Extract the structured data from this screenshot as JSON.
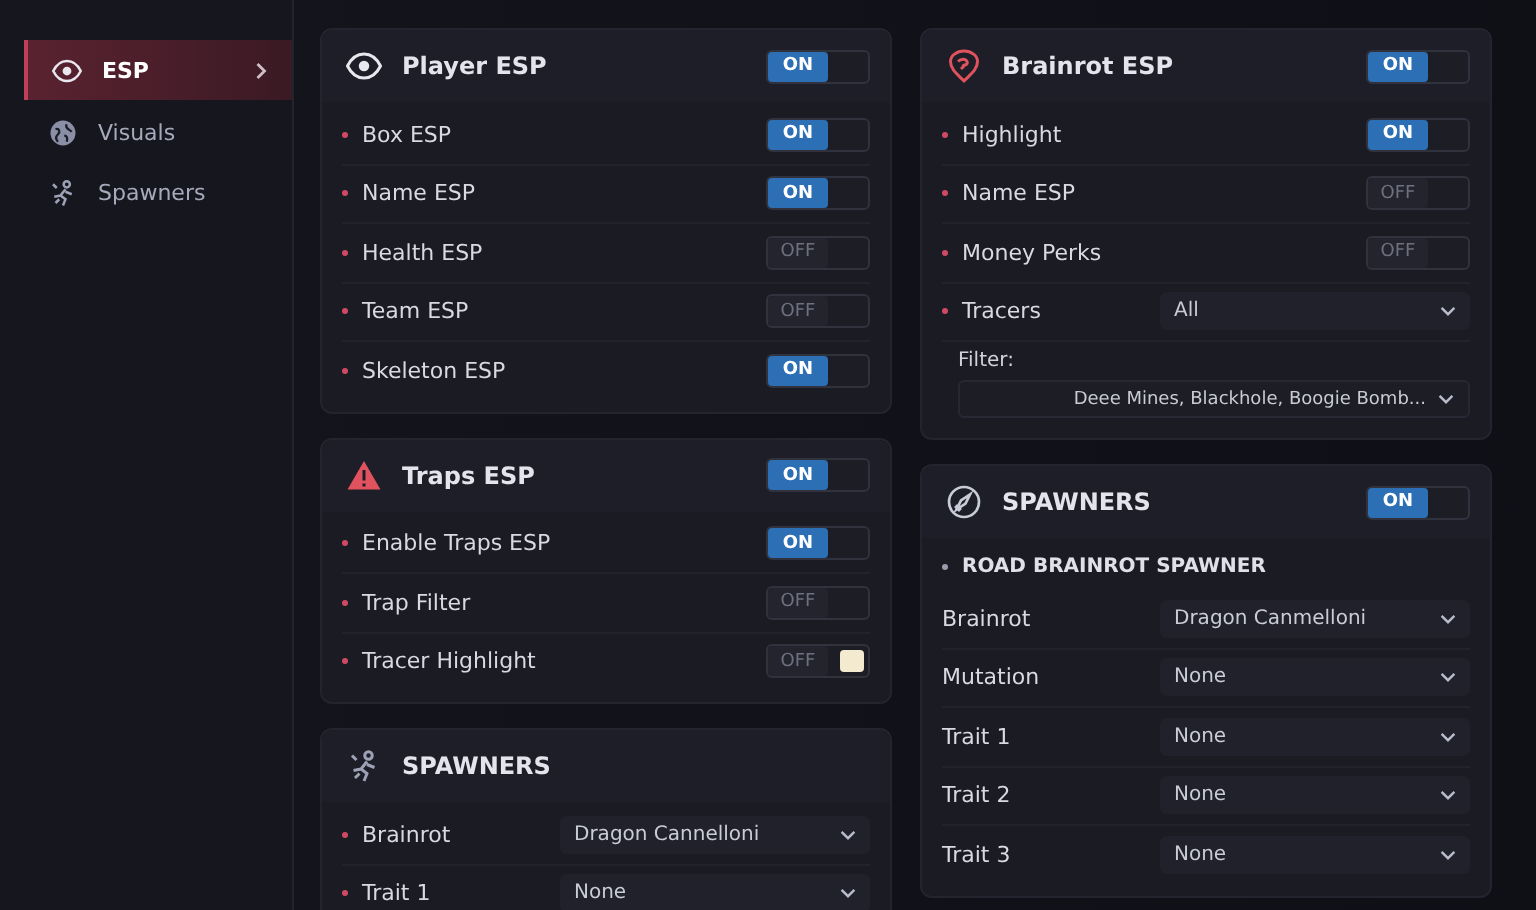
{
  "sidebar": {
    "items": [
      {
        "label": "ESP",
        "selected": true
      },
      {
        "label": "Visuals",
        "selected": false
      },
      {
        "label": "Spawners",
        "selected": false
      }
    ]
  },
  "columns": [
    [
      {
        "title": "Player ESP",
        "toggle": {
          "on": true,
          "label": "ON"
        },
        "rows": [
          {
            "kind": "toggle",
            "label": "Box ESP",
            "bullet": true,
            "on": true,
            "state": "ON"
          },
          {
            "kind": "toggle",
            "label": "Name ESP",
            "bullet": true,
            "on": true,
            "state": "ON"
          },
          {
            "kind": "toggle",
            "label": "Health ESP",
            "bullet": true,
            "on": false,
            "state": "OFF"
          },
          {
            "kind": "toggle",
            "label": "Team ESP",
            "bullet": true,
            "on": false,
            "state": "OFF"
          },
          {
            "kind": "toggle",
            "label": "Skeleton ESP",
            "bullet": true,
            "on": true,
            "state": "ON"
          }
        ]
      },
      {
        "title": "Traps ESP",
        "toggle": {
          "on": true,
          "label": "ON"
        },
        "rows": [
          {
            "kind": "toggle",
            "label": "Enable Traps ESP",
            "bullet": true,
            "on": true,
            "state": "ON"
          },
          {
            "kind": "toggle",
            "label": "Trap Filter",
            "bullet": true,
            "on": false,
            "state": "OFF"
          },
          {
            "kind": "toggle",
            "label": "Tracer Highlight",
            "bullet": true,
            "on": false,
            "state": "OFF",
            "color": "#f3ead0"
          }
        ]
      },
      {
        "title": "SPAWNERS",
        "rows": [
          {
            "kind": "select",
            "label": "Brainrot",
            "bullet": true,
            "value": "Dragon Cannelloni"
          },
          {
            "kind": "select",
            "label": "Trait 1",
            "bullet": true,
            "value": "None"
          }
        ]
      }
    ],
    [
      {
        "title": "Brainrot ESP",
        "toggle": {
          "on": true,
          "label": "ON"
        },
        "rows": [
          {
            "kind": "toggle",
            "label": "Highlight",
            "bullet": true,
            "on": true,
            "state": "ON"
          },
          {
            "kind": "toggle",
            "label": "Name ESP",
            "bullet": true,
            "on": false,
            "state": "OFF"
          },
          {
            "kind": "toggle",
            "label": "Money Perks",
            "bullet": true,
            "on": false,
            "state": "OFF"
          },
          {
            "kind": "select",
            "label": "Tracers",
            "bullet": true,
            "value": "All"
          },
          {
            "kind": "filter",
            "label": "Filter:",
            "value": "Deee Mines, Blackhole, Boogie Bomb..."
          }
        ]
      },
      {
        "title": "SPAWNERS",
        "toggle": {
          "on": true,
          "label": "ON"
        },
        "rows": [
          {
            "kind": "heading",
            "label": "ROAD BRAINROT SPAWNER",
            "bullet": true
          },
          {
            "kind": "select",
            "label": "Brainrot",
            "bullet": false,
            "value": "Dragon Canmelloni"
          },
          {
            "kind": "select",
            "label": "Mutation",
            "bullet": false,
            "value": "None"
          },
          {
            "kind": "select",
            "label": "Trait 1",
            "bullet": false,
            "value": "None"
          },
          {
            "kind": "select",
            "label": "Trait 2",
            "bullet": false,
            "value": "None"
          },
          {
            "kind": "select",
            "label": "Trait 3",
            "bullet": false,
            "value": "None"
          }
        ]
      }
    ]
  ]
}
